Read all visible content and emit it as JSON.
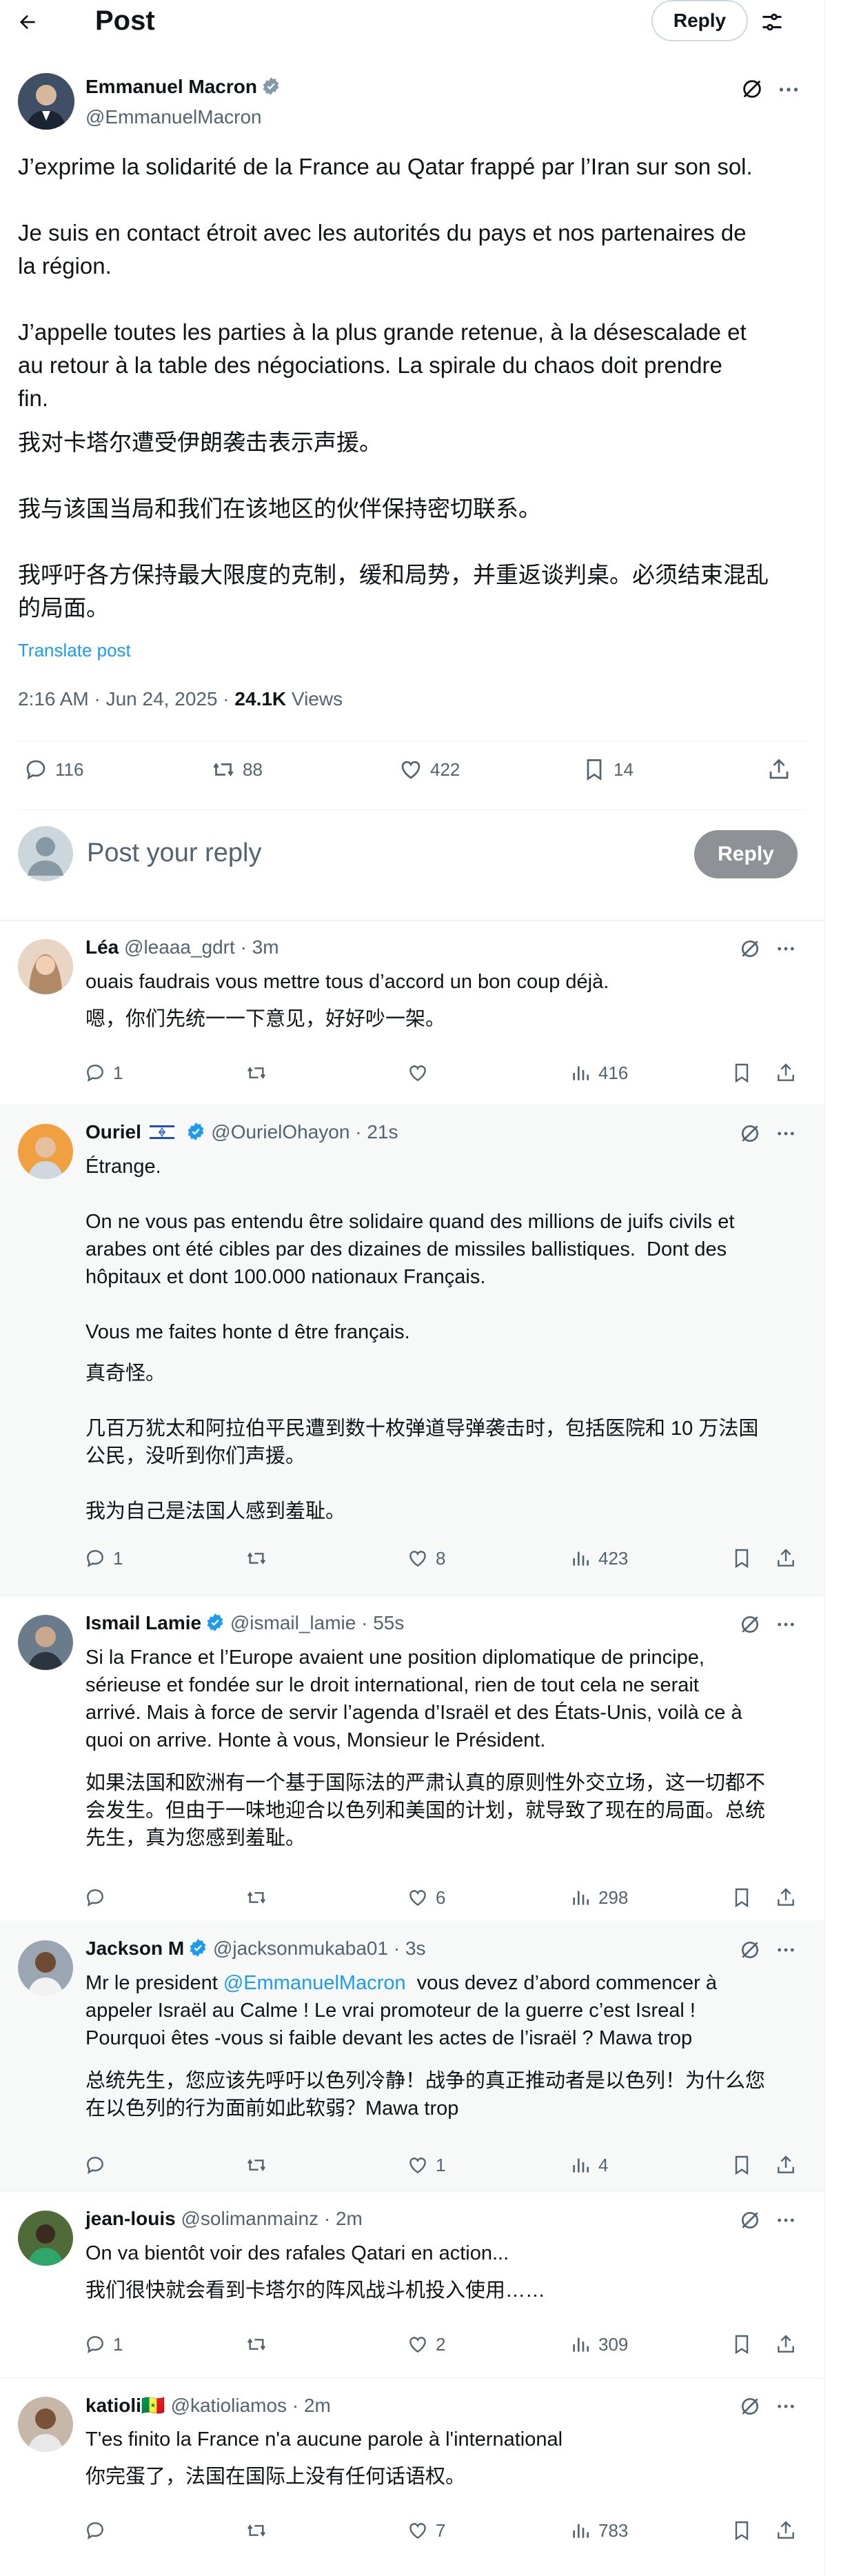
{
  "header": {
    "title": "Post",
    "reply_label": "Reply"
  },
  "post": {
    "author_name": "Emmanuel Macron",
    "author_handle": "@EmmanuelMacron",
    "text_fr": "J’exprime la solidarité de la France au Qatar frappé par l’Iran sur son sol.\n\nJe suis en contact étroit avec les autorités du pays et nos partenaires de\nla région.\n\nJ’appelle toutes les parties à la plus grande retenue, à la désescalade et\nau retour à la table des négociations. La spirale du chaos doit prendre\nfin.",
    "text_zh": "我对卡塔尔遭受伊朗袭击表示声援。\n\n我与该国当局和我们在该地区的伙伴保持密切联系。\n\n我呼吁各方保持最大限度的克制，缓和局势，并重返谈判桌。必须结束混乱\n的局面。",
    "translate_label": "Translate post",
    "timestamp": "2:16 AM · Jun 24, 2025 · ",
    "views_count": "24.1K",
    "views_label": " Views",
    "replies": "116",
    "reposts": "88",
    "likes": "422",
    "bookmarks": "14"
  },
  "compose": {
    "placeholder": "Post your reply",
    "button": "Reply"
  },
  "replies": [
    {
      "name": "Léa",
      "handle": "@leaaa_gdrt",
      "time": " · 3m",
      "text_fr": "ouais faudrais vous mettre tous d’accord un bon coup déjà.",
      "text_zh": "嗯，你们先统一一下意见，好好吵一架。",
      "replies": "1",
      "reposts": "",
      "likes": "",
      "views": "416"
    },
    {
      "name": "Ouriel",
      "handle": "@OurielOhayon",
      "time": " · 21s",
      "text_fr": "Étrange.\n\nOn ne vous pas entendu être solidaire quand des millions de juifs civils et\narabes ont été cibles par des dizaines de missiles ballistiques.  Dont des\nhôpitaux et dont 100.000 nationaux Français.\n\nVous me faites honte d être français.",
      "text_zh": "真奇怪。\n\n几百万犹太和阿拉伯平民遭到数十枚弹道导弹袭击时，包括医院和 10 万法国\n公民，没听到你们声援。\n\n我为自己是法国人感到羞耻。",
      "replies": "1",
      "reposts": "",
      "likes": "8",
      "views": "423"
    },
    {
      "name": "Ismail Lamie",
      "handle": "@ismail_lamie",
      "time": " · 55s",
      "text_fr": "Si la France et l’Europe avaient une position diplomatique de principe,\nsérieuse et fondée sur le droit international, rien de tout cela ne serait\narrivé. Mais à force de servir l’agenda d’Israël et des États-Unis, voilà ce à\nquoi on arrive. Honte à vous, Monsieur le Président.",
      "text_zh": "如果法国和欧洲有一个基于国际法的严肃认真的原则性外交立场，这一切都不\n会发生。但由于一味地迎合以色列和美国的计划，就导致了现在的局面。总统\n先生，真为您感到羞耻。",
      "replies": "",
      "reposts": "",
      "likes": "6",
      "views": "298"
    },
    {
      "name": "Jackson M",
      "handle": "@jacksonmukaba01",
      "time": " · 3s",
      "text_fr_prefix": "Mr le president ",
      "text_fr_mention": "@EmmanuelMacron",
      "text_fr": "  vous devez d’abord commencer à\nappeler Israël au Calme ! Le vrai promoteur de la guerre c’est Isreal !\nPourquoi êtes -vous si faible devant les actes de l’israël ? Mawa trop",
      "text_zh": "总统先生，您应该先呼吁以色列冷静！战争的真正推动者是以色列！为什么您\n在以色列的行为面前如此软弱？Mawa trop",
      "replies": "",
      "reposts": "",
      "likes": "1",
      "views": "4"
    },
    {
      "name": "jean-louis",
      "handle": "@solimanmainz",
      "time": " · 2m",
      "text_fr": "On va bientôt voir des rafales Qatari en action...",
      "text_zh": "我们很快就会看到卡塔尔的阵风战斗机投入使用……",
      "replies": "1",
      "reposts": "",
      "likes": "2",
      "views": "309"
    },
    {
      "name": "katioli🇸🇳",
      "handle": "@katioliamos",
      "time": " · 2m",
      "text_fr": "T'es finito la France n'a aucune parole à l'international",
      "text_zh": "你完蛋了，法国在国际上没有任何话语权。",
      "replies": "",
      "reposts": "",
      "likes": "7",
      "views": "783"
    }
  ]
}
